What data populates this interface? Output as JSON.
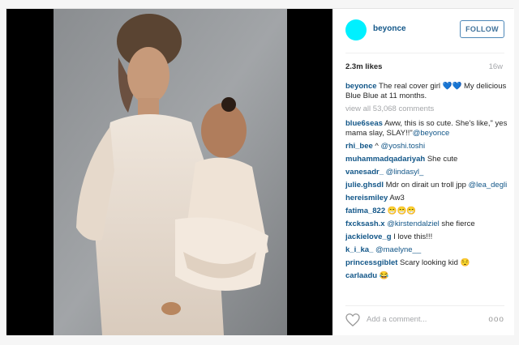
{
  "post": {
    "username": "beyonce",
    "follow_label": "FOLLOW",
    "likes": "2.3m likes",
    "age": "16w",
    "avatar_color": "#00f0ff",
    "caption_user": "beyonce",
    "caption_text": " The real cover girl 💙💙 My delicious Blue Blue at 11 months.",
    "view_all": "view all 53,068 comments"
  },
  "comments": [
    {
      "user": "blue6seas",
      "text": " Aww, this is so cute. She's like,\" yes mama slay, SLAY!!\"",
      "mention": "@beyonce"
    },
    {
      "user": "rhi_bee",
      "text": " ^ ",
      "mention": "@yoshi.toshi"
    },
    {
      "user": "muhammadqadariyah",
      "text": " She cute",
      "mention": ""
    },
    {
      "user": "vanesadr_",
      "text": " ",
      "mention": "@lindasyl_"
    },
    {
      "user": "julie.ghsdl",
      "text": " Mdr on dirait un troll jpp ",
      "mention": "@lea_degli"
    },
    {
      "user": "hereismiley",
      "text": " Aw3",
      "mention": ""
    },
    {
      "user": "fatima_822",
      "text": " 😁😁😁",
      "mention": ""
    },
    {
      "user": "fxcksash.x",
      "text": " ",
      "mention": "@kirstendalziel",
      "after": " she fierce"
    },
    {
      "user": "jackielove_g",
      "text": " I love this!!!",
      "mention": ""
    },
    {
      "user": "k_i_ka_",
      "text": " ",
      "mention": "@maelyne__"
    },
    {
      "user": "princessgiblet",
      "text": " Scary looking kid 😌",
      "mention": ""
    },
    {
      "user": "carlaadu",
      "text": " 😂",
      "mention": ""
    }
  ],
  "footer": {
    "add_comment_placeholder": "Add a comment...",
    "more_label": "ooo"
  }
}
